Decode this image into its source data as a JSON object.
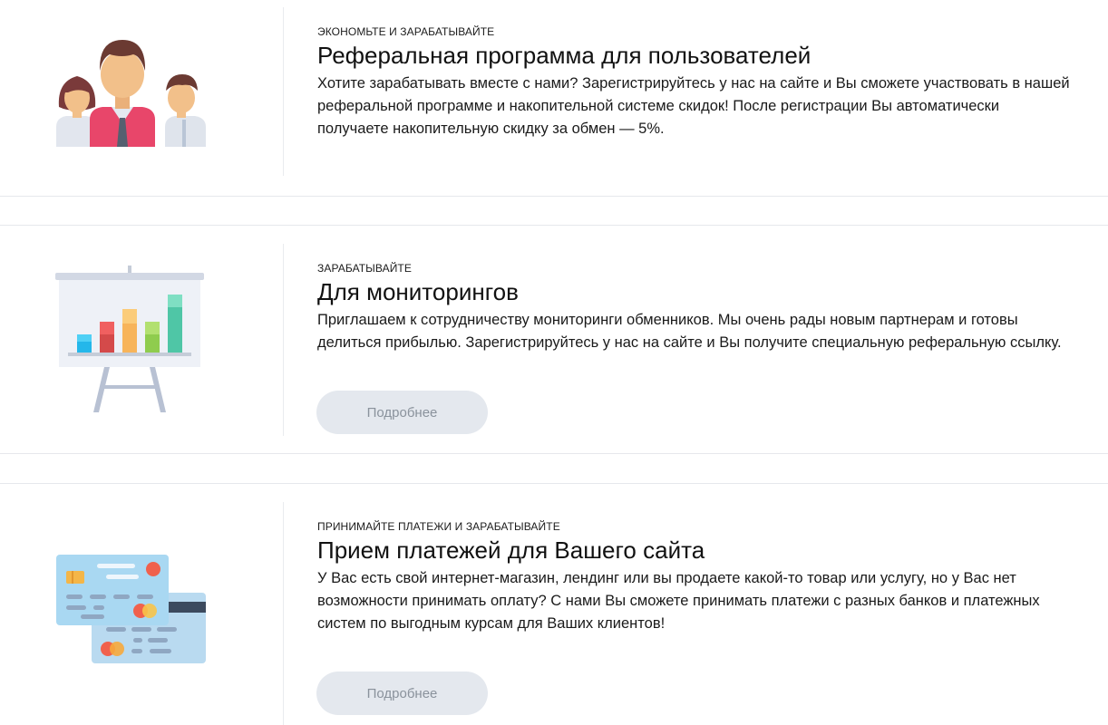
{
  "sections": [
    {
      "eyebrow": "ЭКОНОМЬТЕ И ЗАРАБАТЫВАЙТЕ",
      "title": "Реферальная программа для пользователей",
      "desc_lines": [
        "Хотите зарабатывать вместе с нами? Зарегистрируйтесь у нас на сайте и Вы сможете участвовать в нашей",
        "реферальной программе и накопительной системе скидок! После регистрации Вы автоматически",
        "получаете накопительную скидку за обмен — 5%."
      ],
      "icon": "people-group-icon"
    },
    {
      "eyebrow": "ЗАРАБАТЫВАЙТЕ",
      "title": "Для мониторингов",
      "desc_lines": [
        "Приглашаем к сотрудничеству мониторинги обменников. Мы очень рады новым партнерам и готовы",
        "делиться прибылью. Зарегистрируйтесь у нас на сайте и Вы получите специальную реферальную ссылку."
      ],
      "button": "Подробнее",
      "icon": "presentation-chart-icon"
    },
    {
      "eyebrow": "ПРИНИМАЙТЕ ПЛАТЕЖИ И ЗАРАБАТЫВАЙТЕ",
      "title": "Прием платежей для Вашего сайта",
      "desc_lines": [
        "У Вас есть свой интернет-магазин, лендинг или вы продаете какой-то товар или услугу, но у Вас нет",
        "возможности принимать оплату? С нами Вы сможете принимать платежи с разных банков и платежных",
        "систем по выгодным курсам для Ваших клиентов!"
      ],
      "button": "Подробнее",
      "icon": "credit-cards-icon"
    }
  ],
  "colors": {
    "button_bg": "#e4e8ee",
    "button_text": "#8a929c",
    "divider": "#e6e8ec"
  }
}
